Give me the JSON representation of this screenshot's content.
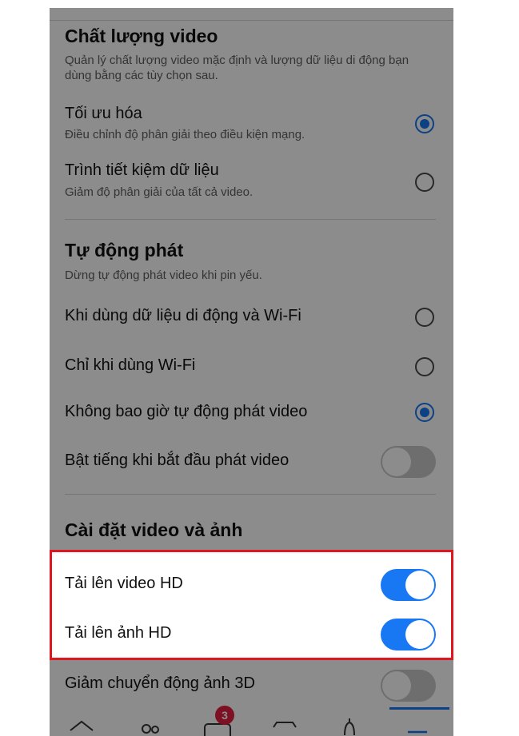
{
  "video_quality": {
    "title": "Chất lượng video",
    "description": "Quản lý chất lượng video mặc định và lượng dữ liệu di động bạn dùng bằng các tùy chọn sau.",
    "options": [
      {
        "label": "Tối ưu hóa",
        "sub": "Điều chỉnh độ phân giải theo điều kiện mạng.",
        "selected": true
      },
      {
        "label": "Trình tiết kiệm dữ liệu",
        "sub": "Giảm độ phân giải của tất cả video.",
        "selected": false
      }
    ]
  },
  "autoplay": {
    "title": "Tự động phát",
    "description": "Dừng tự động phát video khi pin yếu.",
    "options": [
      {
        "label": "Khi dùng dữ liệu di động và Wi-Fi",
        "selected": false
      },
      {
        "label": "Chỉ khi dùng Wi-Fi",
        "selected": false
      },
      {
        "label": "Không bao giờ tự động phát video",
        "selected": true
      }
    ],
    "sound_toggle": {
      "label": "Bật tiếng khi bắt đầu phát video",
      "on": false
    }
  },
  "video_photo_settings": {
    "title": "Cài đặt video và ảnh",
    "toggles": [
      {
        "label": "Tải lên video HD",
        "on": true
      },
      {
        "label": "Tải lên ảnh HD",
        "on": true
      },
      {
        "label": "Giảm chuyển động ảnh 3D",
        "on": false
      }
    ]
  },
  "bottom_nav": {
    "items": [
      "home-icon",
      "friends-icon",
      "video-icon",
      "marketplace-icon",
      "notifications-icon",
      "menu-icon"
    ],
    "badge": "3"
  },
  "colors": {
    "accent": "#1877f2",
    "highlight_border": "#e0161e",
    "badge": "#e41e3f"
  }
}
